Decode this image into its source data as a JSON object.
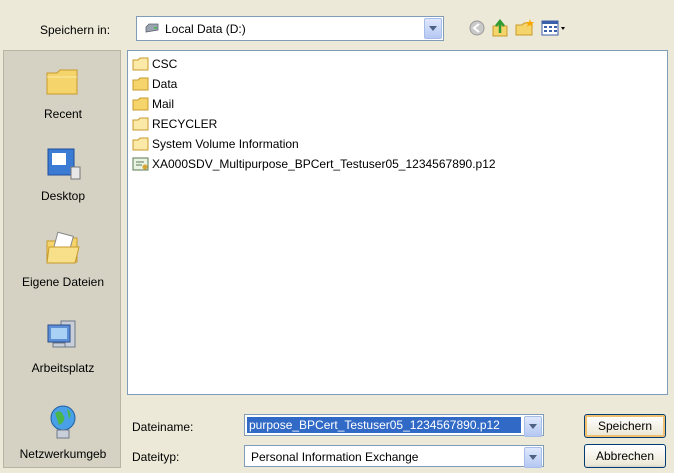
{
  "header": {
    "look_in_label": "Speichern in:",
    "location": "Local Data (D:)"
  },
  "places": [
    {
      "label": "Recent"
    },
    {
      "label": "Desktop"
    },
    {
      "label": "Eigene Dateien"
    },
    {
      "label": "Arbeitsplatz"
    },
    {
      "label": "Netzwerkumgeb"
    }
  ],
  "files": [
    {
      "name": "CSC"
    },
    {
      "name": "Data"
    },
    {
      "name": "Mail"
    },
    {
      "name": "RECYCLER"
    },
    {
      "name": "System Volume Information"
    },
    {
      "name": "XA000SDV_Multipurpose_BPCert_Testuser05_1234567890.p12"
    }
  ],
  "form": {
    "filename_label": "Dateiname:",
    "filename_value": "purpose_BPCert_Testuser05_1234567890.p12",
    "filetype_label": "Dateityp:",
    "filetype_value": "Personal Information Exchange"
  },
  "buttons": {
    "save": "Speichern",
    "cancel": "Abbrechen"
  }
}
